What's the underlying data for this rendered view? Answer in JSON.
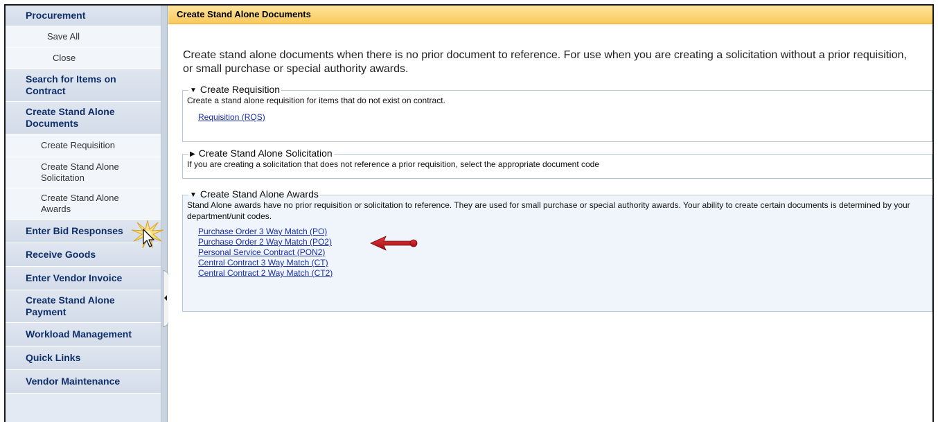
{
  "sidebar": {
    "items": [
      {
        "label": "Procurement",
        "kind": "top"
      },
      {
        "label": "Save All",
        "kind": "sub"
      },
      {
        "label": "Close",
        "kind": "sub"
      },
      {
        "label": "Search for Items on Contract",
        "kind": "top"
      },
      {
        "label": "Create Stand Alone Documents",
        "kind": "top"
      },
      {
        "label": "Create Requisition",
        "kind": "sub"
      },
      {
        "label": "Create Stand Alone Solicitation",
        "kind": "sub"
      },
      {
        "label": "Create Stand Alone Awards",
        "kind": "sub"
      },
      {
        "label": "Enter Bid Responses",
        "kind": "top"
      },
      {
        "label": "Receive Goods",
        "kind": "top"
      },
      {
        "label": "Enter Vendor Invoice",
        "kind": "top"
      },
      {
        "label": "Create Stand Alone Payment",
        "kind": "top"
      },
      {
        "label": "Workload Management",
        "kind": "top"
      },
      {
        "label": "Quick Links",
        "kind": "top"
      },
      {
        "label": "Vendor Maintenance",
        "kind": "top"
      }
    ]
  },
  "main": {
    "header_title": "Create Stand Alone Documents",
    "intro": "Create stand alone documents when there is no prior document to reference. For use when you are creating a solicitation without a prior requisition, or small purchase or special authority awards.",
    "groups": [
      {
        "title": "Create Requisition",
        "expanded": true,
        "description": "Create a stand alone requisition for items that do not exist on contract.",
        "links": [
          "Requisition (RQS)"
        ]
      },
      {
        "title": "Create Stand Alone Solicitation",
        "expanded": false,
        "description": "If you are creating a solicitation that does not reference a prior requisition, select the appropriate document code",
        "links": []
      },
      {
        "title": "Create Stand Alone Awards",
        "expanded": true,
        "description": "Stand Alone awards have no prior requisition or solicitation to reference. They are used for small purchase or special authority awards. Your ability to create certain documents is determined by your department/unit codes.",
        "links": [
          "Purchase Order 3 Way Match (PO)",
          "Purchase Order 2 Way Match (PO2)",
          "Personal Service Contract (PON2)",
          "Central Contract 3 Way Match (CT)",
          "Central Contract 2 Way Match (CT2)"
        ]
      }
    ]
  },
  "icons": {
    "expanded": "triangle-down-icon",
    "collapsed": "triangle-right-icon"
  },
  "colors": {
    "header_gradient_top": "#fde59d",
    "header_gradient_bottom": "#f9c85a",
    "sidebar_bg": "#e4eaf3",
    "link": "#1a2fa8",
    "annotation_arrow": "#c0141a"
  }
}
